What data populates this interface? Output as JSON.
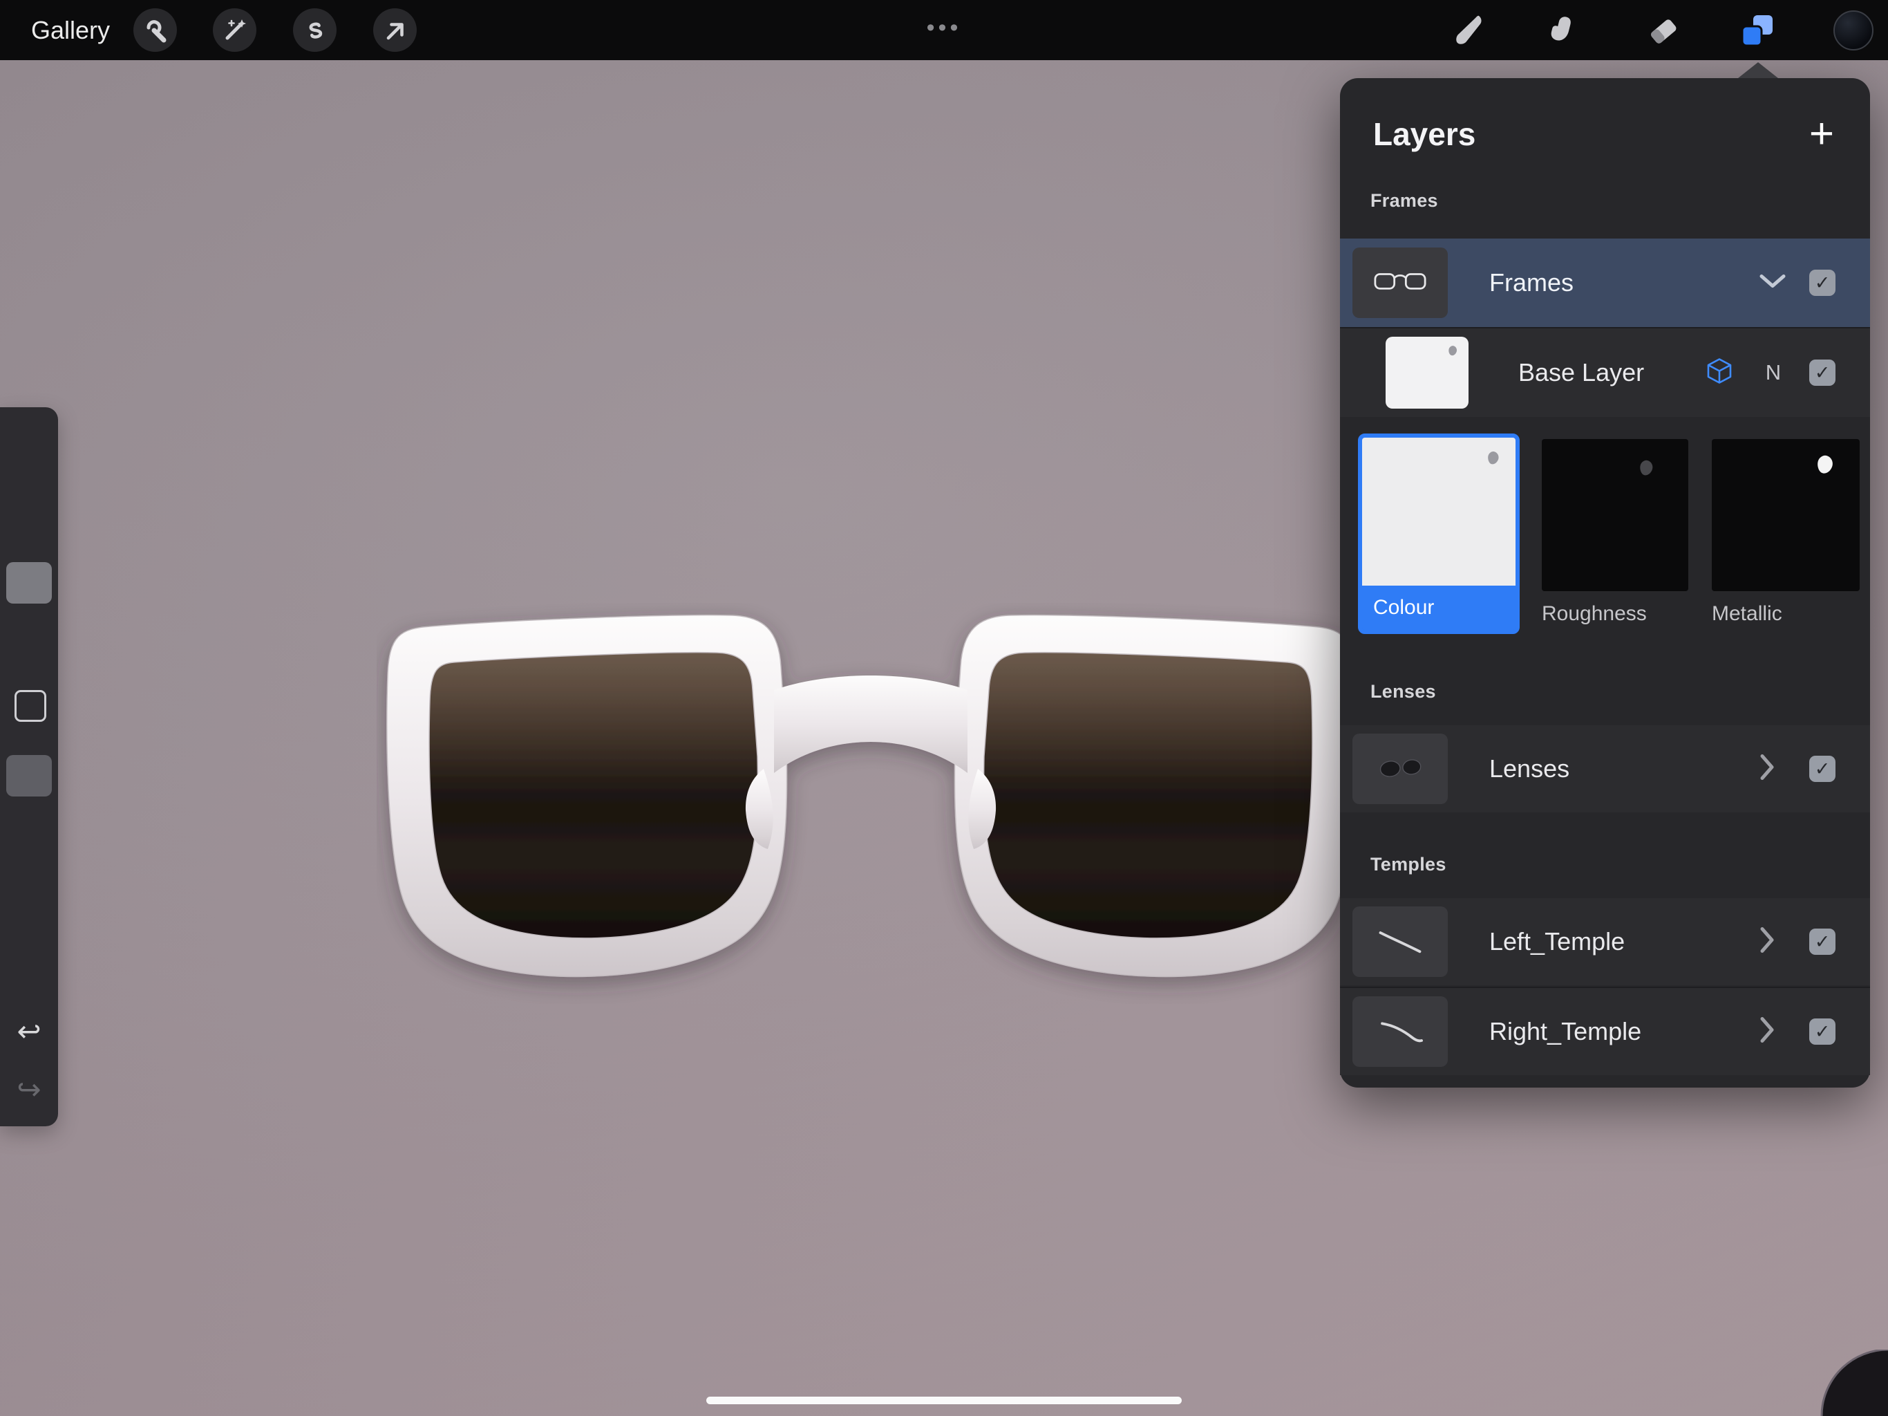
{
  "glyphs": {
    "check": "✓",
    "undo": "↩",
    "redo": "↪",
    "plus": "+",
    "ellipsis": "•••"
  },
  "colors": {
    "accent": "#2f7cf6",
    "panel_bg": "#27272a",
    "selected_row": "#3d4a63",
    "topbar_bg": "#0b0b0c"
  },
  "topbar": {
    "gallery_label": "Gallery"
  },
  "panel": {
    "title": "Layers",
    "sections": {
      "frames": "Frames",
      "lenses": "Lenses",
      "temples": "Temples"
    },
    "rows": {
      "frames": {
        "label": "Frames",
        "checked": true
      },
      "base": {
        "label": "Base Layer",
        "blend": "N",
        "checked": true
      },
      "lenses": {
        "label": "Lenses",
        "checked": true
      },
      "left_temple": {
        "label": "Left_Temple",
        "checked": true
      },
      "right_temple": {
        "label": "Right_Temple",
        "checked": true
      }
    },
    "materials": [
      {
        "label": "Colour",
        "selected": true
      },
      {
        "label": "Roughness",
        "selected": false
      },
      {
        "label": "Metallic",
        "selected": false
      }
    ]
  }
}
